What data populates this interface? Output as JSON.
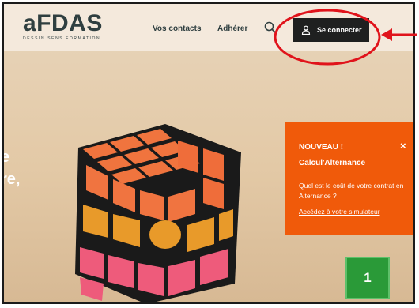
{
  "header": {
    "logo_text": "aFDAS",
    "logo_tagline": "DESSIN SENS FORMATION",
    "nav": [
      "Vos contacts",
      "Adhérer"
    ],
    "search_icon": "search-icon",
    "login_label": "Se connecter",
    "login_icon": "user-icon"
  },
  "hero": {
    "partial_text": [
      "e",
      "re,"
    ]
  },
  "popup": {
    "badge": "NOUVEAU !",
    "close": "×",
    "title": "Calcul'Alternance",
    "question": "Quel est le coût de votre contrat en Alternance ?",
    "link": "Accédez à votre simulateur"
  },
  "annotation": {
    "step_number": "1",
    "highlight_color": "#e0131b",
    "step_color": "#2a9a38"
  }
}
